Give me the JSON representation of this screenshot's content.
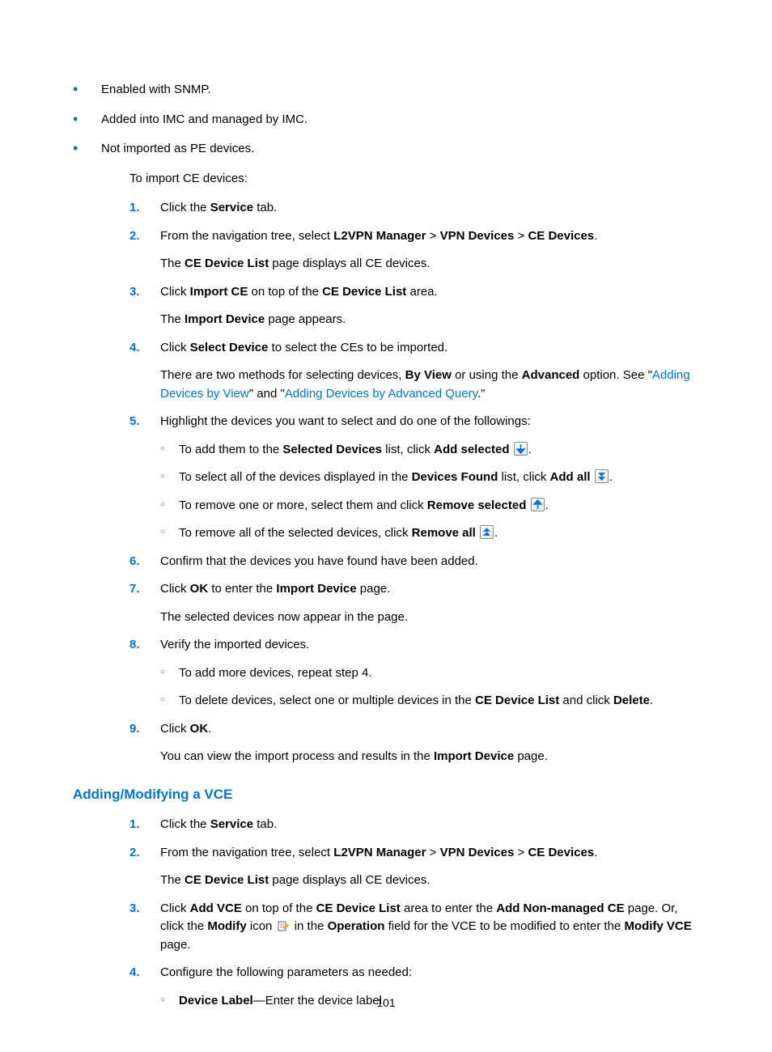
{
  "bullets": [
    "Enabled with SNMP.",
    "Added into IMC and managed by IMC.",
    "Not imported as PE devices."
  ],
  "intro": "To import CE devices:",
  "steps": [
    {
      "n": "1.",
      "lines": [
        {
          "segs": [
            {
              "t": "Click the "
            },
            {
              "t": "Service",
              "b": true
            },
            {
              "t": " tab."
            }
          ]
        }
      ]
    },
    {
      "n": "2.",
      "lines": [
        {
          "segs": [
            {
              "t": "From the navigation tree, select "
            },
            {
              "t": "L2VPN Manager",
              "b": true
            },
            {
              "t": " > "
            },
            {
              "t": "VPN Devices",
              "b": true
            },
            {
              "t": " > "
            },
            {
              "t": "CE Devices",
              "b": true
            },
            {
              "t": "."
            }
          ]
        },
        {
          "segs": [
            {
              "t": "The "
            },
            {
              "t": "CE Device List",
              "b": true
            },
            {
              "t": " page displays all CE devices."
            }
          ]
        }
      ]
    },
    {
      "n": "3.",
      "lines": [
        {
          "segs": [
            {
              "t": "Click "
            },
            {
              "t": "Import CE",
              "b": true
            },
            {
              "t": " on top of the "
            },
            {
              "t": "CE Device List",
              "b": true
            },
            {
              "t": " area."
            }
          ]
        },
        {
          "segs": [
            {
              "t": "The "
            },
            {
              "t": "Import Device",
              "b": true
            },
            {
              "t": " page appears."
            }
          ]
        }
      ]
    },
    {
      "n": "4.",
      "lines": [
        {
          "segs": [
            {
              "t": "Click "
            },
            {
              "t": "Select Device",
              "b": true
            },
            {
              "t": " to select the CEs to be imported."
            }
          ]
        },
        {
          "segs": [
            {
              "t": "There are two methods for selecting devices, "
            },
            {
              "t": "By View",
              "b": true
            },
            {
              "t": " or using the "
            },
            {
              "t": "Advanced",
              "b": true
            },
            {
              "t": " option. See \""
            },
            {
              "t": "Adding Devices by View",
              "link": true
            },
            {
              "t": "\" and \""
            },
            {
              "t": "Adding Devices by Advanced Query",
              "link": true
            },
            {
              "t": ".\""
            }
          ]
        }
      ]
    },
    {
      "n": "5.",
      "lines": [
        {
          "segs": [
            {
              "t": "Highlight the devices you want to select and do one of the followings:"
            }
          ]
        }
      ],
      "sub": [
        {
          "segs": [
            {
              "t": "To add them to the "
            },
            {
              "t": "Selected Devices",
              "b": true
            },
            {
              "t": " list, click "
            },
            {
              "t": "Add selected",
              "b": true
            },
            {
              "t": " "
            },
            {
              "icon": "down"
            },
            {
              "t": "."
            }
          ]
        },
        {
          "segs": [
            {
              "t": "To select all of the devices displayed in the "
            },
            {
              "t": "Devices Found",
              "b": true
            },
            {
              "t": " list, click "
            },
            {
              "t": "Add all",
              "b": true
            },
            {
              "t": " "
            },
            {
              "icon": "down-all"
            },
            {
              "t": "."
            }
          ]
        },
        {
          "segs": [
            {
              "t": "To remove one or more, select them and click "
            },
            {
              "t": "Remove selected",
              "b": true
            },
            {
              "t": " "
            },
            {
              "icon": "up"
            },
            {
              "t": "."
            }
          ]
        },
        {
          "segs": [
            {
              "t": "To remove all of the selected devices, click "
            },
            {
              "t": "Remove all",
              "b": true
            },
            {
              "t": " "
            },
            {
              "icon": "up-all"
            },
            {
              "t": "."
            }
          ]
        }
      ]
    },
    {
      "n": "6.",
      "lines": [
        {
          "segs": [
            {
              "t": "Confirm that the devices you have found have been added."
            }
          ]
        }
      ]
    },
    {
      "n": "7.",
      "lines": [
        {
          "segs": [
            {
              "t": "Click "
            },
            {
              "t": "OK",
              "b": true
            },
            {
              "t": " to enter the "
            },
            {
              "t": "Import Device",
              "b": true
            },
            {
              "t": " page."
            }
          ]
        },
        {
          "segs": [
            {
              "t": "The selected devices now appear in the page."
            }
          ]
        }
      ]
    },
    {
      "n": "8.",
      "lines": [
        {
          "segs": [
            {
              "t": "Verify the imported devices."
            }
          ]
        }
      ],
      "sub": [
        {
          "segs": [
            {
              "t": "To add more devices, repeat step 4."
            }
          ]
        },
        {
          "segs": [
            {
              "t": "To delete devices, select one or multiple devices in the "
            },
            {
              "t": "CE Device List",
              "b": true
            },
            {
              "t": " and click "
            },
            {
              "t": "Delete",
              "b": true
            },
            {
              "t": "."
            }
          ]
        }
      ]
    },
    {
      "n": "9.",
      "lines": [
        {
          "segs": [
            {
              "t": "Click "
            },
            {
              "t": "OK",
              "b": true
            },
            {
              "t": "."
            }
          ]
        },
        {
          "segs": [
            {
              "t": "You can view the import process and results in the "
            },
            {
              "t": "Import Device",
              "b": true
            },
            {
              "t": " page."
            }
          ]
        }
      ]
    }
  ],
  "heading2": "Adding/Modifying a VCE",
  "steps2": [
    {
      "n": "1.",
      "lines": [
        {
          "segs": [
            {
              "t": "Click the "
            },
            {
              "t": "Service",
              "b": true
            },
            {
              "t": " tab."
            }
          ]
        }
      ]
    },
    {
      "n": "2.",
      "lines": [
        {
          "segs": [
            {
              "t": "From the navigation tree, select "
            },
            {
              "t": "L2VPN Manager",
              "b": true
            },
            {
              "t": " > "
            },
            {
              "t": "VPN Devices",
              "b": true
            },
            {
              "t": " > "
            },
            {
              "t": "CE Devices",
              "b": true
            },
            {
              "t": "."
            }
          ]
        },
        {
          "segs": [
            {
              "t": "The "
            },
            {
              "t": "CE Device List",
              "b": true
            },
            {
              "t": " page displays all CE devices."
            }
          ]
        }
      ]
    },
    {
      "n": "3.",
      "lines": [
        {
          "segs": [
            {
              "t": "Click "
            },
            {
              "t": "Add VCE",
              "b": true
            },
            {
              "t": " on top of the "
            },
            {
              "t": "CE Device List",
              "b": true
            },
            {
              "t": " area to enter the "
            },
            {
              "t": "Add Non-managed CE",
              "b": true
            },
            {
              "t": " page. Or, click the "
            },
            {
              "t": "Modify",
              "b": true
            },
            {
              "t": " icon "
            },
            {
              "icon": "edit"
            },
            {
              "t": " in the "
            },
            {
              "t": "Operation",
              "b": true
            },
            {
              "t": " field for the VCE to be modified to enter the "
            },
            {
              "t": "Modify VCE",
              "b": true
            },
            {
              "t": " page."
            }
          ]
        }
      ]
    },
    {
      "n": "4.",
      "lines": [
        {
          "segs": [
            {
              "t": "Configure the following parameters as needed:"
            }
          ]
        }
      ],
      "sub": [
        {
          "segs": [
            {
              "t": "Device Label",
              "b": true
            },
            {
              "t": "—Enter the device label."
            }
          ]
        }
      ]
    }
  ],
  "pageNumber": "101"
}
